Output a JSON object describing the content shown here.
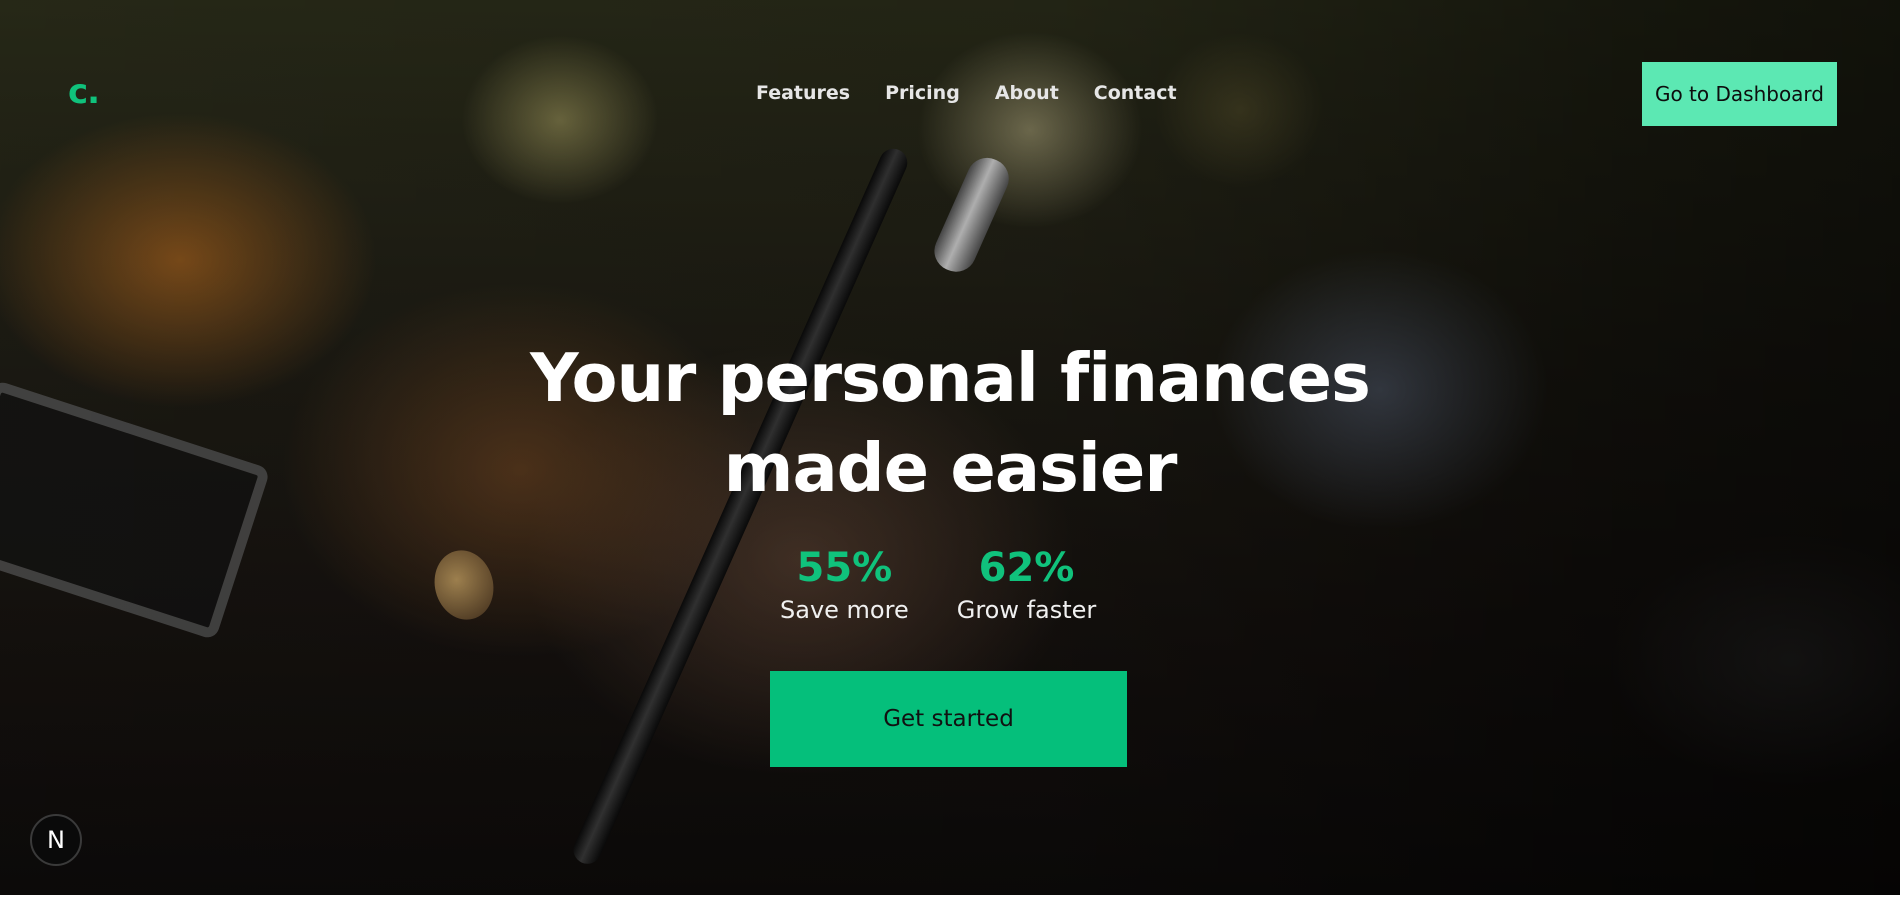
{
  "brand": {
    "logo": "c.",
    "accent_color": "#10c27c"
  },
  "nav": {
    "items": [
      {
        "label": "Features"
      },
      {
        "label": "Pricing"
      },
      {
        "label": "About"
      },
      {
        "label": "Contact"
      }
    ],
    "dashboard_label": "Go to Dashboard"
  },
  "hero": {
    "headline_line1": "Your personal finances",
    "headline_line2": "made easier",
    "background": "blurred photo of a hand holding a pen",
    "stats": [
      {
        "value": "55%",
        "label": "Save more"
      },
      {
        "value": "62%",
        "label": "Grow faster"
      }
    ],
    "cta_label": "Get started"
  },
  "dev_badge": {
    "icon": "nextjs-icon",
    "glyph": "N"
  }
}
